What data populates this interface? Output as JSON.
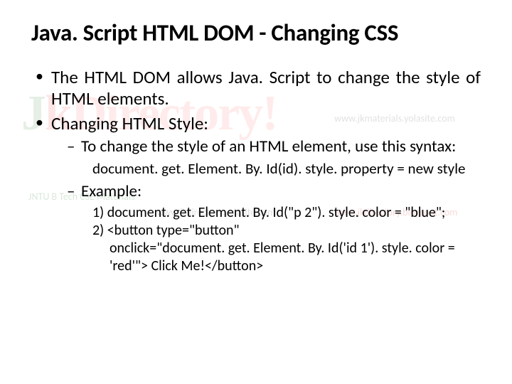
{
  "title": "Java. Script HTML DOM - Changing CSS",
  "bullets": {
    "b1": "The HTML DOM allows Java. Script to change the style of HTML elements.",
    "b2": "Changing HTML Style:",
    "b2_sub1": "To change the style of an HTML element, use this syntax:",
    "b2_code": "document. get. Element. By. Id(id). style. property = new style",
    "b2_sub2": "Example:",
    "ex1": "1) document. get. Element. By. Id(\"p 2\"). style. color = \"blue\";",
    "ex2a": "2) <button type=\"button\"",
    "ex2b": "onclick=\"document. get. Element. By. Id('id 1'). style. color =",
    "ex2c": "'red'\"> Click Me!</button>"
  },
  "watermark": {
    "j": "J",
    "k": "k",
    "rest": "Directory!",
    "sub1": "JNTU B Tech CSE Materials",
    "sub2": "www.jkdirectory.yolasite.com",
    "sub3": "www.jkdirectory.blogspot.com",
    "sub4": "www.jkmaterials.yolasite.com"
  }
}
